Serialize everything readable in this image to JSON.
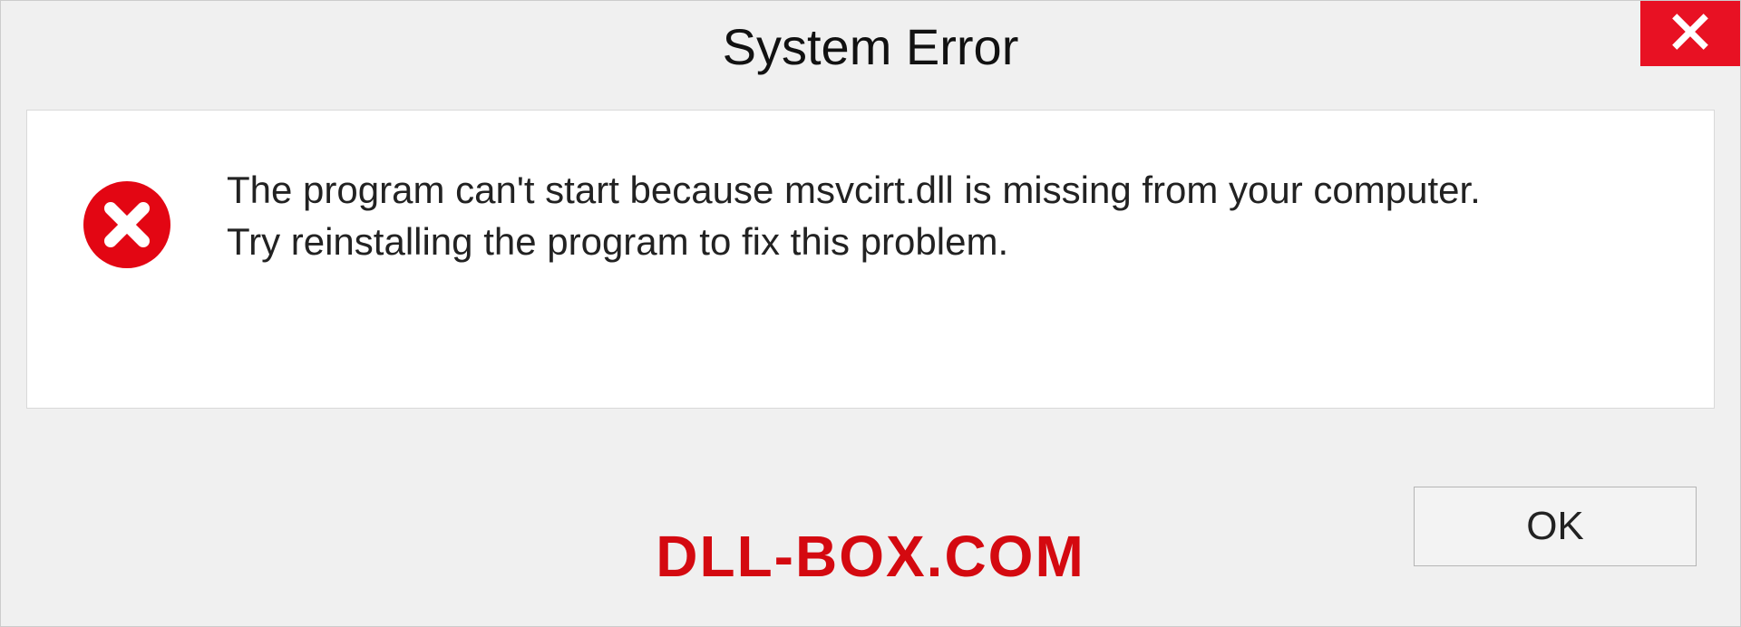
{
  "dialog": {
    "title": "System Error",
    "message_line1": "The program can't start because msvcirt.dll is missing from your computer.",
    "message_line2": "Try reinstalling the program to fix this problem.",
    "ok_label": "OK"
  },
  "branding": {
    "text": "DLL-BOX.COM"
  },
  "colors": {
    "close_bg": "#e81123",
    "brand_text": "#d40910"
  }
}
